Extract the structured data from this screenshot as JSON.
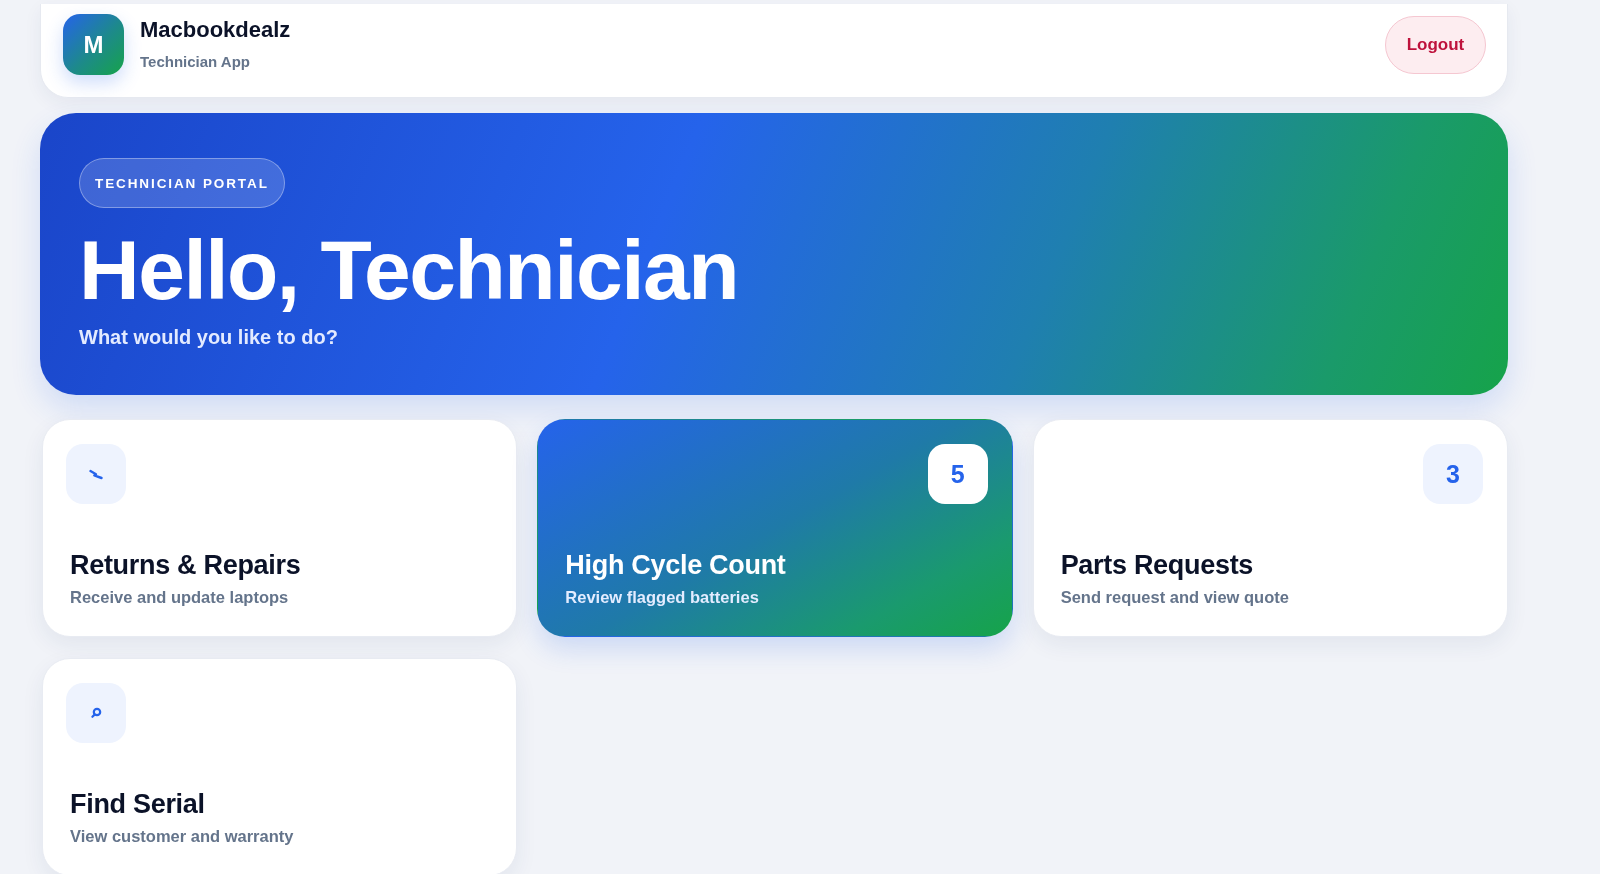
{
  "header": {
    "logo_letter": "M",
    "brand": "Macbookdealz",
    "subtitle": "Technician App",
    "logout": "Logout"
  },
  "hero": {
    "badge": "TECHNICIAN PORTAL",
    "heading": "Hello, Technician",
    "subheading": "What would you like to do?"
  },
  "actions": [
    {
      "kind": "icon",
      "title": "Returns & Repairs",
      "description": "Receive and update laptops",
      "selected": false
    },
    {
      "kind": "count",
      "count": "5",
      "title": "High Cycle Count",
      "description": "Review flagged batteries",
      "selected": true
    },
    {
      "kind": "count",
      "count": "3",
      "title": "Parts Requests",
      "description": "Send request and view quote",
      "selected": false
    },
    {
      "kind": "icon",
      "title": "Find Serial",
      "description": "View customer and warranty",
      "selected": false
    }
  ]
}
